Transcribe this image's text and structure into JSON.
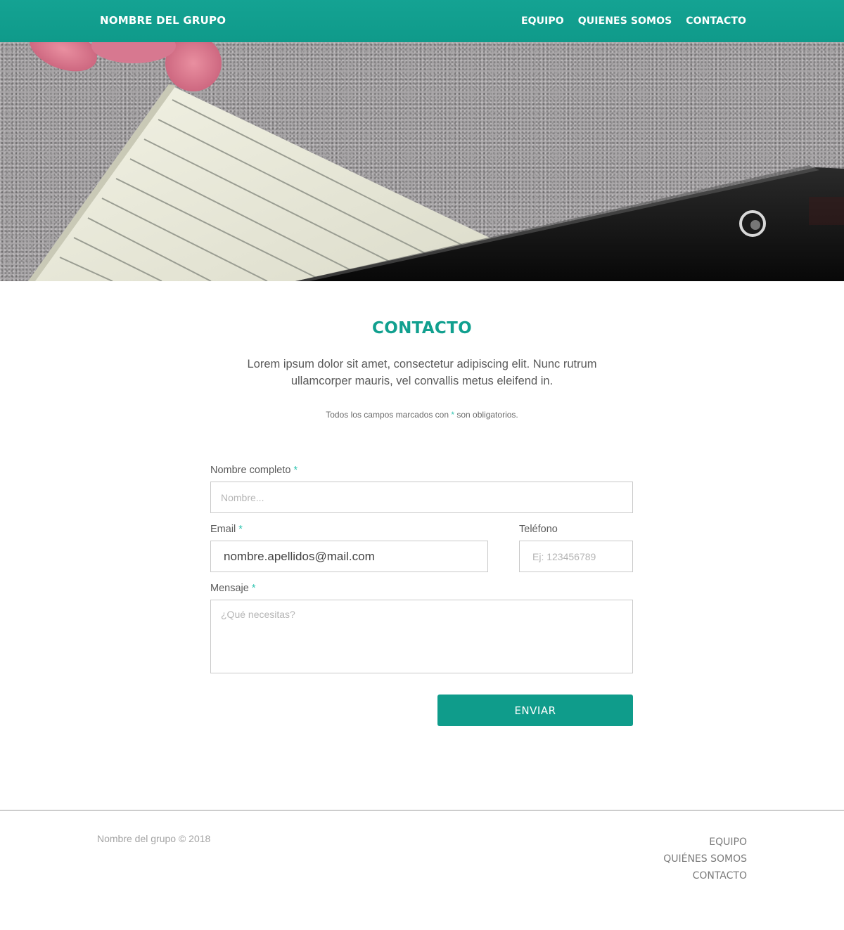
{
  "navbar": {
    "brand": "NOMBRE DEL GRUPO",
    "links": [
      "EQUIPO",
      "QUIENES SOMOS",
      "CONTACTO"
    ]
  },
  "contact": {
    "title": "CONTACTO",
    "lead": "Lorem ipsum dolor sit amet, consectetur adipiscing elit. Nunc rutrum ullamcorper mauris, vel convallis metus eleifend in.",
    "note_before": "Todos los campos marcados con ",
    "note_star": "*",
    "note_after": " son obligatorios.",
    "fields": {
      "name": {
        "label": "Nombre completo",
        "required_mark": "*",
        "placeholder": "Nombre...",
        "value": ""
      },
      "email": {
        "label": "Email",
        "required_mark": "*",
        "placeholder": "",
        "value": "nombre.apellidos@mail.com"
      },
      "phone": {
        "label": "Teléfono",
        "placeholder": "Ej: 123456789",
        "value": ""
      },
      "message": {
        "label": "Mensaje",
        "required_mark": "*",
        "placeholder": "¿Qué necesitas?",
        "value": ""
      }
    },
    "submit_label": "ENVIAR"
  },
  "footer": {
    "copyright": "Nombre del grupo © 2018",
    "links": [
      "EQUIPO",
      "QUIÉNES SOMOS",
      "CONTACTO"
    ]
  },
  "colors": {
    "accent": "#0f9c8b",
    "title": "#11a08f",
    "required_star": "#2ec4b0"
  }
}
